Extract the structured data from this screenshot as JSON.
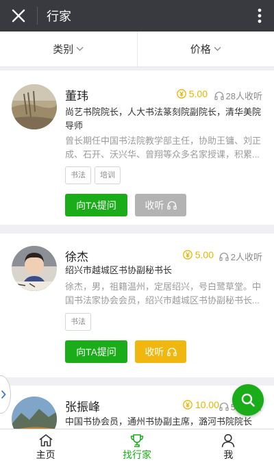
{
  "header": {
    "title": "行家"
  },
  "filters": [
    {
      "label": "类别"
    },
    {
      "label": "价格"
    }
  ],
  "experts": [
    {
      "name": "董玮",
      "price": "5.00",
      "listen_count": "28人收听",
      "title": "尚艺书院院长，人大书法篆刻院副院长，清华美院导师",
      "bio": "曾长期任中国书法院教学部主任，协助王镛、刘正成、石开、沃兴华、曾翔等众多名家授课，积累...",
      "tags": [
        "书法",
        "培训"
      ],
      "ask_label": "向TA提问",
      "listen_label": "收听"
    },
    {
      "name": "徐杰",
      "price": "5.00",
      "listen_count": "2人收听",
      "title": "绍兴市越城区书协副秘书长",
      "bio": "徐杰，男，祖籍温州，定居绍兴，号白鹭草堂。中国书法家协会会员，绍兴市越城区书协副秘书长...",
      "tags": [
        "书法"
      ],
      "ask_label": "向TA提问",
      "listen_label": "收听"
    },
    {
      "name": "张振峰",
      "price": "10.00",
      "listen_count": "5人收听",
      "title": "中国书协会员，通州书协副主席，潞河书院院长"
    }
  ],
  "tabbar": [
    {
      "label": "主页"
    },
    {
      "label": "找行家"
    },
    {
      "label": "我"
    }
  ],
  "colors": {
    "accent": "#1aad19",
    "gold": "#f0b711",
    "header_bg": "#393a3f"
  }
}
